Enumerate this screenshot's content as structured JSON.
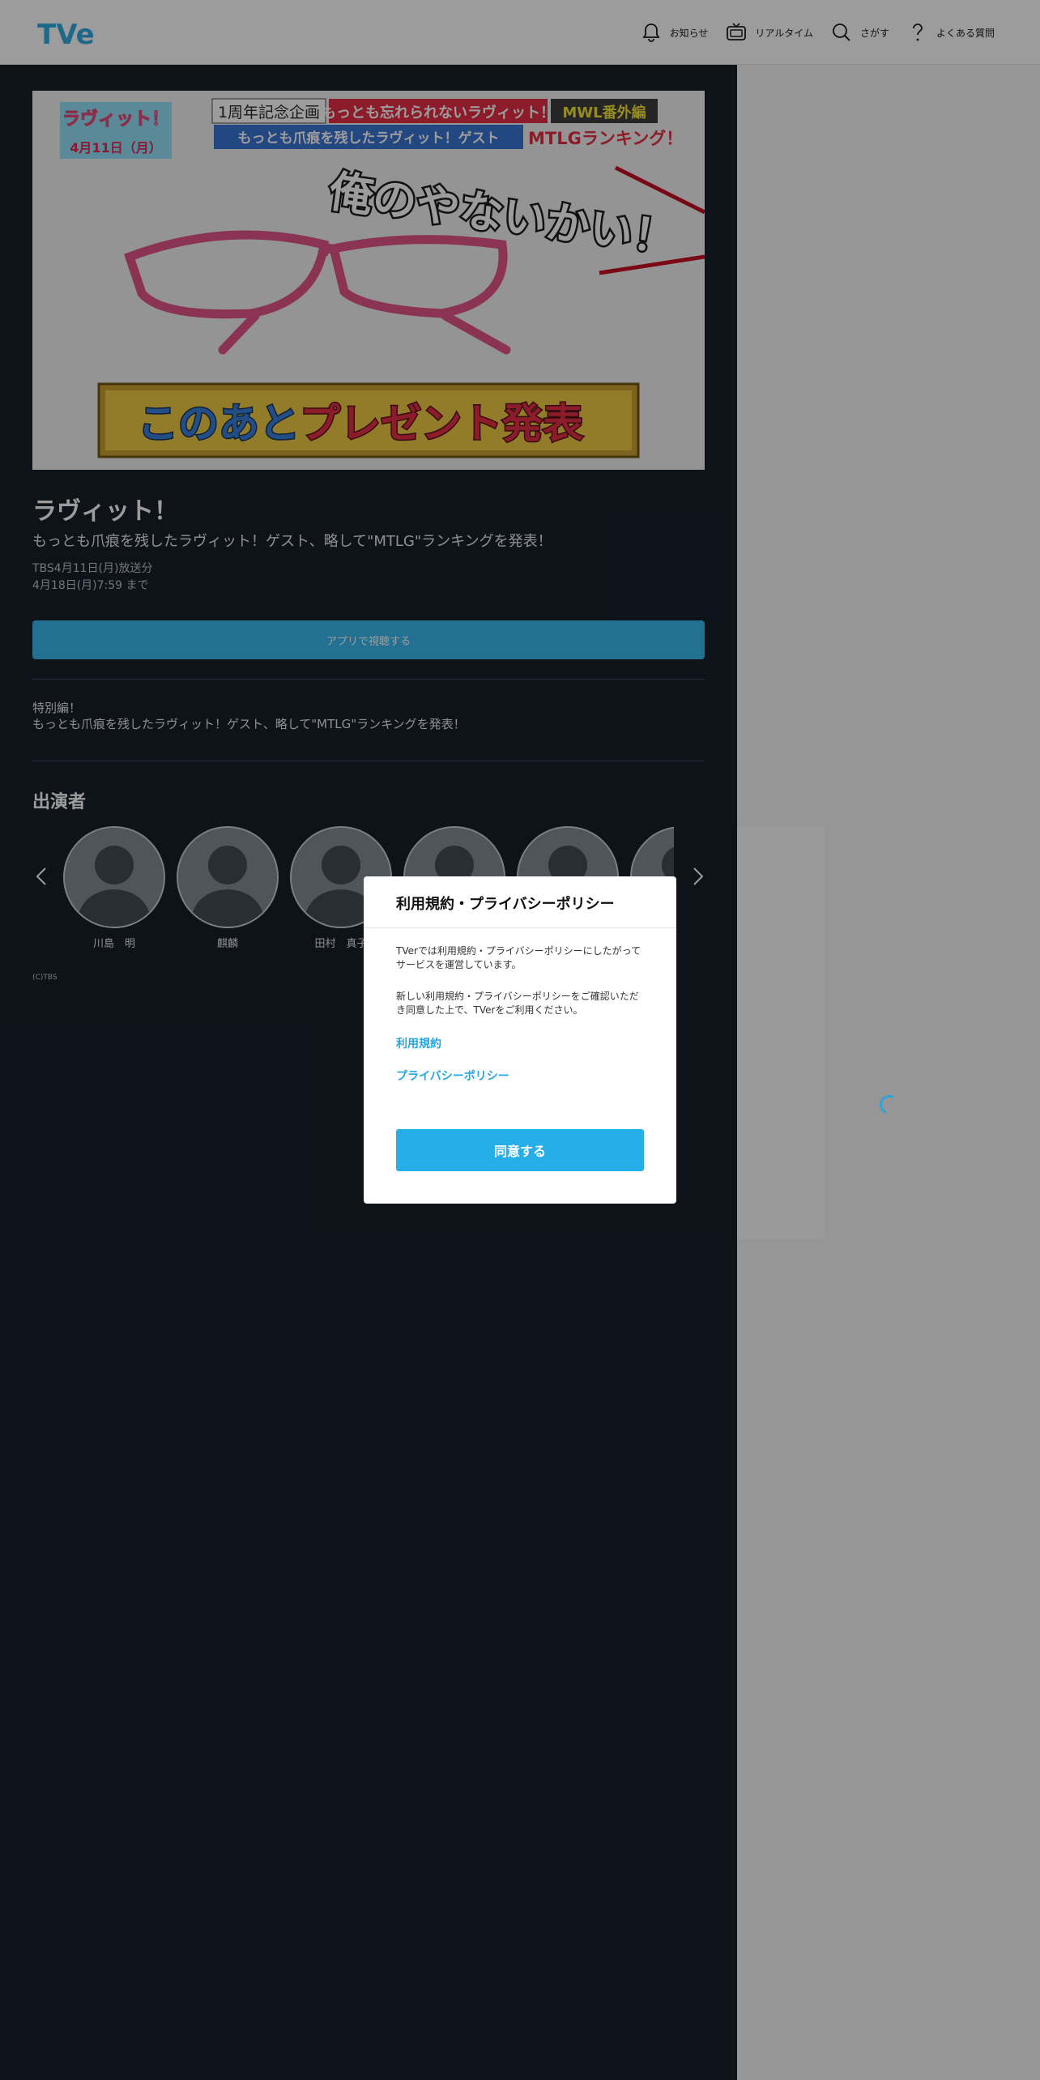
{
  "header": {
    "logo_text": "TVer",
    "nav": [
      {
        "label": "お知らせ",
        "icon": "bell-icon"
      },
      {
        "label": "リアルタイム",
        "icon": "tv-icon"
      },
      {
        "label": "さがす",
        "icon": "search-icon"
      },
      {
        "label": "よくある質問",
        "icon": "question-icon"
      }
    ]
  },
  "episode": {
    "thumbnail": {
      "show_logo": "ラヴィット！",
      "date_badge": "4月11日（月）",
      "banner_top_a": "1周年記念企画",
      "banner_top_b": "もっとも忘れられないラヴィット！",
      "banner_top_c": "MWL番外編",
      "banner_second_a": "もっとも爪痕を残したラヴィット！ゲスト",
      "banner_second_b": "MTLGランキング！",
      "quote": "俺のやないかい！",
      "bottom_banner_a": "このあと",
      "bottom_banner_b": "プレゼント発表"
    },
    "title": "ラヴィット！",
    "subtitle": "もっとも爪痕を残したラヴィット！ゲスト、略して\"MTLG\"ランキングを発表！",
    "broadcast": "TBS4月11日(月)放送分",
    "expiry": "4月18日(月)7:59 まで",
    "app_button": "アプリで視聴する",
    "description_line1": "特別編！",
    "description_line2": "もっとも爪痕を残したラヴィット！ゲスト、略して\"MTLG\"ランキングを発表！"
  },
  "cast": {
    "heading": "出演者",
    "members": [
      "川島　明",
      "麒麟",
      "田村　真子",
      "",
      "",
      ""
    ]
  },
  "copyright": "(C)TBS",
  "modal": {
    "title": "利用規約・プライバシーポリシー",
    "text1": "TVerでは利用規約・プライバシーポリシーにしたがってサービスを運営しています。",
    "text2": "新しい利用規約・プライバシーポリシーをご確認いただき同意した上で、TVerをご利用ください。",
    "link_terms": "利用規約",
    "link_privacy": "プライバシーポリシー",
    "agree_button": "同意する"
  },
  "colors": {
    "accent": "#26aee8",
    "main_bg": "#0b1320",
    "overlay": "rgba(20,20,20,0.42)"
  }
}
